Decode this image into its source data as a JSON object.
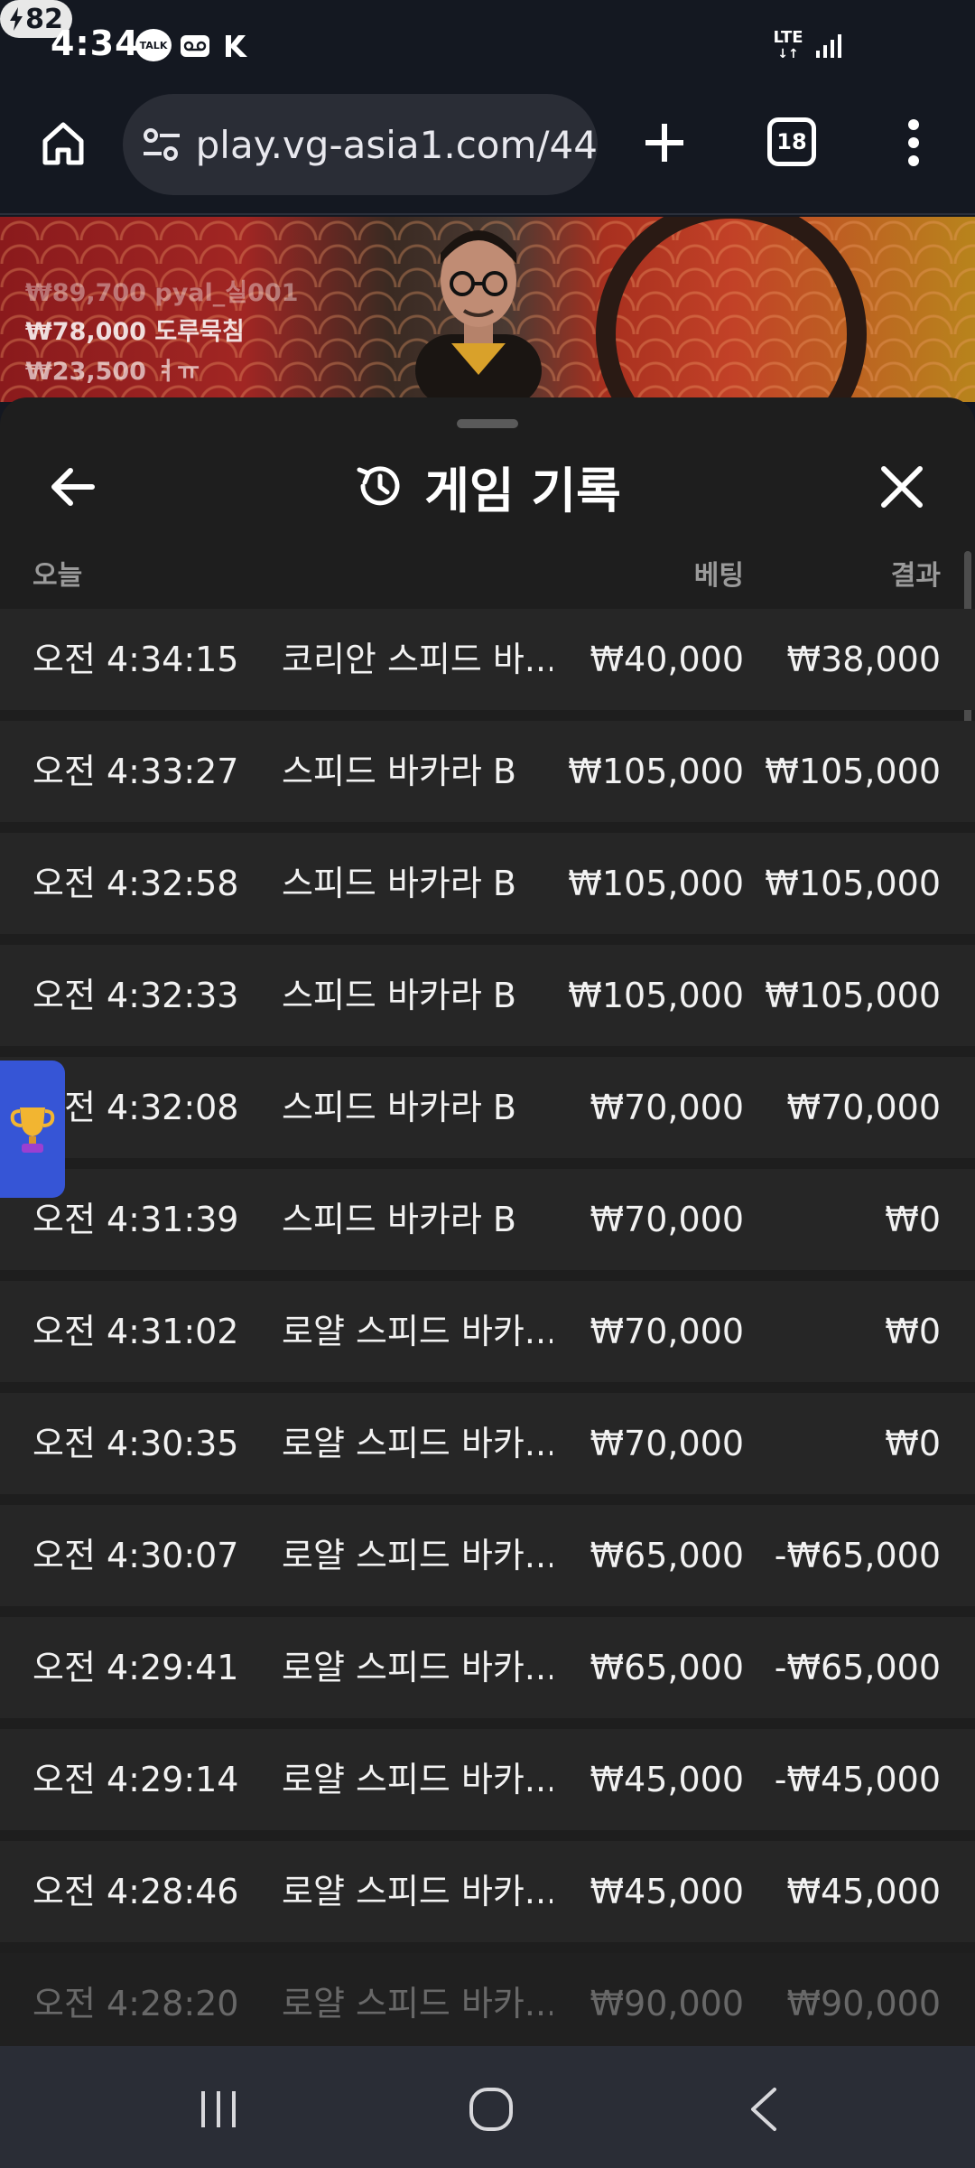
{
  "status_bar": {
    "time": "4:34",
    "talk_badge": "TALK",
    "network": "LTE",
    "battery": "82"
  },
  "browser": {
    "url": "play.vg-asia1.com/44",
    "tab_count": "18"
  },
  "video": {
    "tickers": [
      "₩89,700  pyal_실001",
      "₩78,000  도루묵침",
      "₩23,500  ㅕㅠ"
    ]
  },
  "sheet": {
    "title": "게임 기록",
    "columns": {
      "today": "오늘",
      "bet": "베팅",
      "result": "결과"
    },
    "rows": [
      {
        "time": "오전 4:34:15",
        "game": "코리안 스피드 바...",
        "bet": "₩40,000",
        "result": "₩38,000"
      },
      {
        "time": "오전 4:33:27",
        "game": "스피드 바카라 B",
        "bet": "₩105,000",
        "result": "₩105,000"
      },
      {
        "time": "오전 4:32:58",
        "game": "스피드 바카라 B",
        "bet": "₩105,000",
        "result": "₩105,000"
      },
      {
        "time": "오전 4:32:33",
        "game": "스피드 바카라 B",
        "bet": "₩105,000",
        "result": "₩105,000"
      },
      {
        "time": "오전 4:32:08",
        "game": "스피드 바카라 B",
        "bet": "₩70,000",
        "result": "₩70,000"
      },
      {
        "time": "오전 4:31:39",
        "game": "스피드 바카라 B",
        "bet": "₩70,000",
        "result": "₩0"
      },
      {
        "time": "오전 4:31:02",
        "game": "로얄 스피드 바카...",
        "bet": "₩70,000",
        "result": "₩0"
      },
      {
        "time": "오전 4:30:35",
        "game": "로얄 스피드 바카...",
        "bet": "₩70,000",
        "result": "₩0"
      },
      {
        "time": "오전 4:30:07",
        "game": "로얄 스피드 바카...",
        "bet": "₩65,000",
        "result": "-₩65,000"
      },
      {
        "time": "오전 4:29:41",
        "game": "로얄 스피드 바카...",
        "bet": "₩65,000",
        "result": "-₩65,000"
      },
      {
        "time": "오전 4:29:14",
        "game": "로얄 스피드 바카...",
        "bet": "₩45,000",
        "result": "-₩45,000"
      },
      {
        "time": "오전 4:28:46",
        "game": "로얄 스피드 바카...",
        "bet": "₩45,000",
        "result": "₩45,000"
      },
      {
        "time": "오전 4:28:20",
        "game": "로얄 스피드 바카...",
        "bet": "₩90,000",
        "result": "₩90,000"
      }
    ]
  },
  "icons": {
    "back": "arrow-left-icon",
    "history": "history-icon",
    "close": "close-icon",
    "trophy": "trophy-icon"
  },
  "colors": {
    "sheet_bg": "#1e1e1e",
    "row_bg": "#262626",
    "header_text": "#9a9a9a",
    "accent_blue": "#3655d6"
  }
}
